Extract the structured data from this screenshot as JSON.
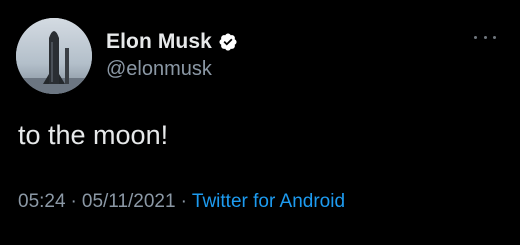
{
  "author": {
    "display_name": "Elon Musk",
    "handle": "@elonmusk",
    "verified": true
  },
  "tweet": {
    "text": "to the moon!",
    "time": "05:24",
    "separator": "·",
    "date": "05/11/2021",
    "source": "Twitter for Android"
  },
  "icons": {
    "avatar": "starship-rocket-avatar",
    "badge": "verified-badge-icon",
    "menu": "more-options-icon"
  },
  "colors": {
    "background": "#000000",
    "primary_text": "#e7e9ea",
    "secondary_text": "#8b98a5",
    "link": "#1d9bf0"
  }
}
